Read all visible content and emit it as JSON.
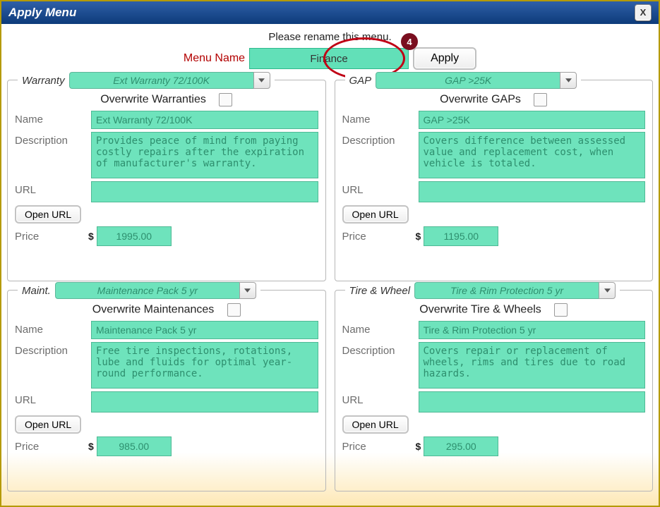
{
  "window": {
    "title": "Apply Menu",
    "close_label": "X"
  },
  "top": {
    "hint": "Please rename this menu.",
    "menu_name_label": "Menu Name",
    "menu_name_value": "Finance",
    "apply_label": "Apply",
    "badge": "4"
  },
  "labels": {
    "name": "Name",
    "description": "Description",
    "url": "URL",
    "open_url": "Open URL",
    "price": "Price",
    "currency": "$"
  },
  "panels": [
    {
      "key": "warranty",
      "legend": "Warranty",
      "dropdown": "Ext Warranty 72/100K",
      "overwrite_label": "Overwrite Warranties",
      "name": "Ext Warranty 72/100K",
      "description": "Provides peace of mind from paying costly repairs after the expiration of manufacturer's warranty.",
      "url": "",
      "price": "1995.00"
    },
    {
      "key": "gap",
      "legend": "GAP",
      "dropdown": "GAP >25K",
      "overwrite_label": "Overwrite GAPs",
      "name": "GAP >25K",
      "description": "Covers difference between assessed value and replacement cost, when vehicle is totaled.",
      "url": "",
      "price": "1195.00"
    },
    {
      "key": "maint",
      "legend": "Maint.",
      "dropdown": "Maintenance Pack 5 yr",
      "overwrite_label": "Overwrite Maintenances",
      "name": "Maintenance Pack 5 yr",
      "description": "Free tire inspections, rotations, lube and fluids for optimal year-round performance.",
      "url": "",
      "price": "985.00"
    },
    {
      "key": "tirewheel",
      "legend": "Tire & Wheel",
      "dropdown": "Tire & Rim Protection 5 yr",
      "overwrite_label": "Overwrite Tire & Wheels",
      "name": "Tire & Rim Protection 5 yr",
      "description": "Covers repair or replacement of wheels, rims and tires due to road hazards.",
      "url": "",
      "price": "295.00"
    }
  ]
}
